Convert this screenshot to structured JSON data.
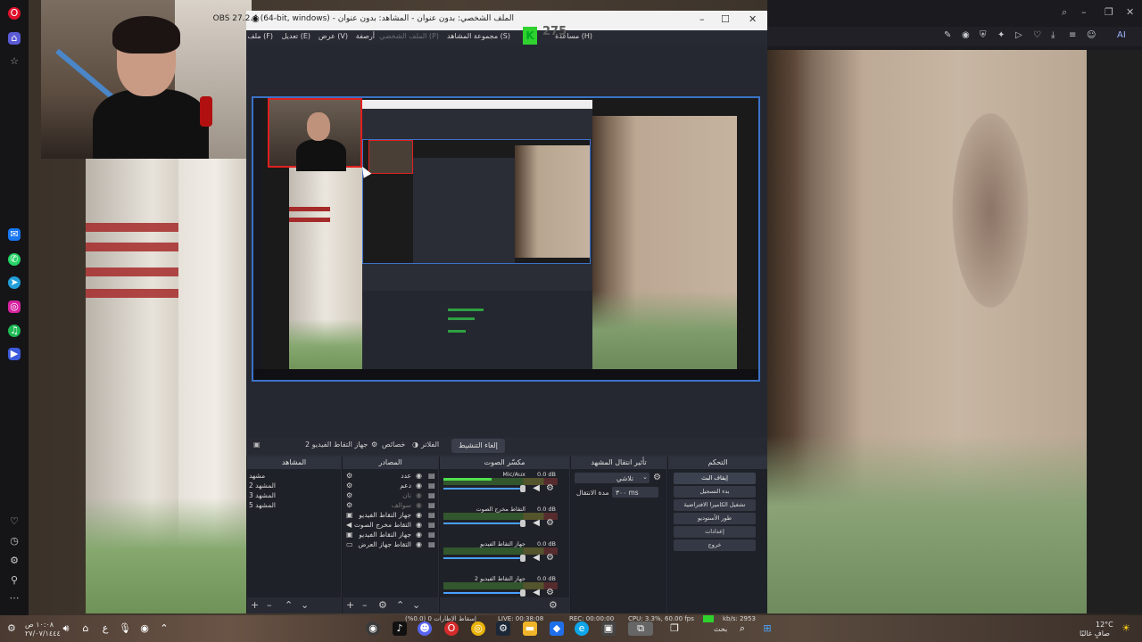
{
  "obs": {
    "title": "OBS 27.2.4 (64-bit, windows) - الملف الشخصي: بدون عنوان - المشاهد: بدون عنوان",
    "menu": [
      "ملف (F)",
      "تعديل (E)",
      "عرض (V)",
      "أرصفة",
      "الملف الشخصي (P)",
      "مجموعة المشاهد (S)",
      "مساعدة (H)"
    ],
    "overlay_count": "275",
    "toolbar": {
      "source_name": "جهاز التقاط الفيديو 2",
      "properties": "خصائص",
      "filters": "الفلاتر",
      "deactivate": "إلغاء التنشيط"
    },
    "scenes": {
      "header": "المشاهد",
      "items": [
        "مشهد",
        "المشهد 2",
        "المشهد 3",
        "المشهد 5"
      ]
    },
    "sources": {
      "header": "المصادر",
      "items": [
        "عدد",
        "دعم",
        "تان",
        "سوالف",
        "جهاز التقاط الفيديو",
        "التقاط مخرج الصوت",
        "جهاز التقاط الفيديو",
        "التقاط جهاز العرض"
      ]
    },
    "mixer": {
      "header": "مكسّر الصوت",
      "channels": [
        {
          "name": "Mic/Aux",
          "db": "0.0 dB",
          "level": 0.42
        },
        {
          "name": "التقاط مخرج الصوت",
          "db": "0.0 dB",
          "level": 0.0
        },
        {
          "name": "جهاز التقاط الفيديو",
          "db": "0.0 dB",
          "level": 0.0
        },
        {
          "name": "جهاز التقاط الفيديو 2",
          "db": "0.0 dB",
          "level": 0.0
        }
      ]
    },
    "transitions": {
      "header": "تأثير انتقال المشهد",
      "type": "تلاشي",
      "duration_label": "مدة الانتقال",
      "duration_value": "٣٠٠ ms"
    },
    "controls": {
      "header": "التحكم",
      "buttons": [
        "إيقاف البث",
        "بدء التسجيل",
        "تشغيل الكاميرا الافتراضية",
        "طور الأستوديو",
        "إعدادات",
        "خروج"
      ]
    },
    "status": {
      "dropped": "إسقاط الإطارات 0 (0.0%)",
      "live": "LIVE: 00:38:08",
      "rec": "REC: 00:00:00",
      "cpu": "CPU: 3.3%, 60.00 fps",
      "kbps": "kb/s: 2953"
    }
  },
  "taskbar": {
    "time": "١٠:٠٨ ص",
    "date": "٢٧/٠٧/١٤٤٤",
    "weather_temp": "12°C",
    "weather_desc": "صافٍ غالبًا",
    "search": "بحث"
  },
  "colors": {
    "accent": "#3c72c8",
    "live_green": "#2fd12f",
    "rec_red": "#e02020"
  }
}
